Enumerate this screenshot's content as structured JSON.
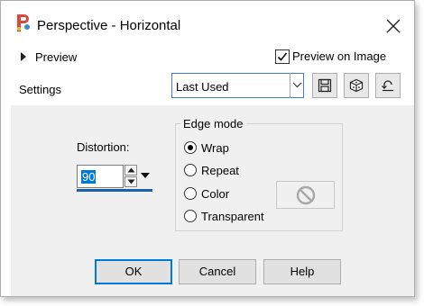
{
  "window": {
    "title": "Perspective - Horizontal"
  },
  "preview": {
    "label": "Preview",
    "preview_on_image_label": "Preview on Image",
    "preview_on_image_checked": true
  },
  "settings": {
    "label": "Settings",
    "preset_value": "Last Used"
  },
  "distortion": {
    "label": "Distortion:",
    "value": "90"
  },
  "edge_mode": {
    "title": "Edge mode",
    "options": [
      {
        "label": "Wrap",
        "selected": true
      },
      {
        "label": "Repeat",
        "selected": false
      },
      {
        "label": "Color",
        "selected": false
      },
      {
        "label": "Transparent",
        "selected": false
      }
    ]
  },
  "buttons": {
    "ok": "OK",
    "cancel": "Cancel",
    "help": "Help"
  },
  "colors": {
    "accent": "#0078d7",
    "content_bg": "#f0f0f0",
    "button_bg": "#e1e1e1"
  },
  "icons": [
    "app-icon",
    "close-icon",
    "expand-triangle-icon",
    "checkmark-icon",
    "dropdown-arrow-icon",
    "save-preset-icon",
    "randomize-icon",
    "reset-defaults-icon",
    "spin-up-icon",
    "spin-down-icon",
    "no-color-icon"
  ]
}
